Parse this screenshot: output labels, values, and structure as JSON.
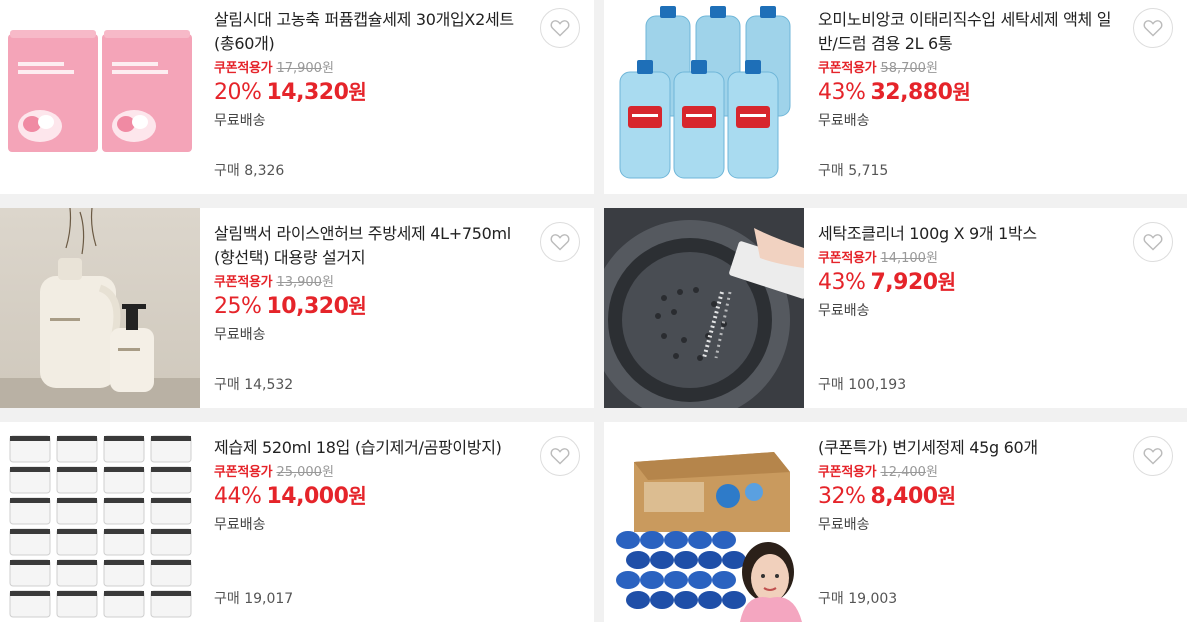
{
  "products": [
    {
      "title": "살림시대 고농축 퍼퓸캡슐세제 30개입X2세트 (총60개)",
      "coupon_label": "쿠폰적용가",
      "original_price": "17,900",
      "won": "원",
      "discount": "20%",
      "price": "14,320",
      "shipping": "무료배송",
      "purchases": "구매 8,326",
      "image": "pink-pouches"
    },
    {
      "title": "오미노비앙코 이태리직수입 세탁세제 액체 일반/드럼 겸용 2L 6통",
      "coupon_label": "쿠폰적용가",
      "original_price": "58,700",
      "won": "원",
      "discount": "43%",
      "price": "32,880",
      "shipping": "무료배송",
      "purchases": "구매 5,715",
      "image": "blue-bottles"
    },
    {
      "title": "살림백서 라이스앤허브 주방세제 4L+750ml (향선택) 대용량 설거지",
      "coupon_label": "쿠폰적용가",
      "original_price": "13,900",
      "won": "원",
      "discount": "25%",
      "price": "10,320",
      "shipping": "무료배송",
      "purchases": "구매 14,532",
      "image": "beige-jugs"
    },
    {
      "title": "세탁조클리너 100g X 9개 1박스",
      "coupon_label": "쿠폰적용가",
      "original_price": "14,100",
      "won": "원",
      "discount": "43%",
      "price": "7,920",
      "shipping": "무료배송",
      "purchases": "구매 100,193",
      "image": "washing-drum"
    },
    {
      "title": "제습제 520ml 18입 (습기제거/곰팡이방지)",
      "coupon_label": "쿠폰적용가",
      "original_price": "25,000",
      "won": "원",
      "discount": "44%",
      "price": "14,000",
      "shipping": "무료배송",
      "purchases": "구매 19,017",
      "image": "dehumidifier-grid"
    },
    {
      "title": "(쿠폰특가) 변기세정제 45g 60개",
      "coupon_label": "쿠폰적용가",
      "original_price": "12,400",
      "won": "원",
      "discount": "32%",
      "price": "8,400",
      "shipping": "무료배송",
      "purchases": "구매 19,003",
      "image": "blue-tablets-box"
    }
  ],
  "wishlist_icon": "heart-icon",
  "colors": {
    "accent": "#e5242a",
    "muted": "#999999",
    "background": "#f1f1f1"
  }
}
